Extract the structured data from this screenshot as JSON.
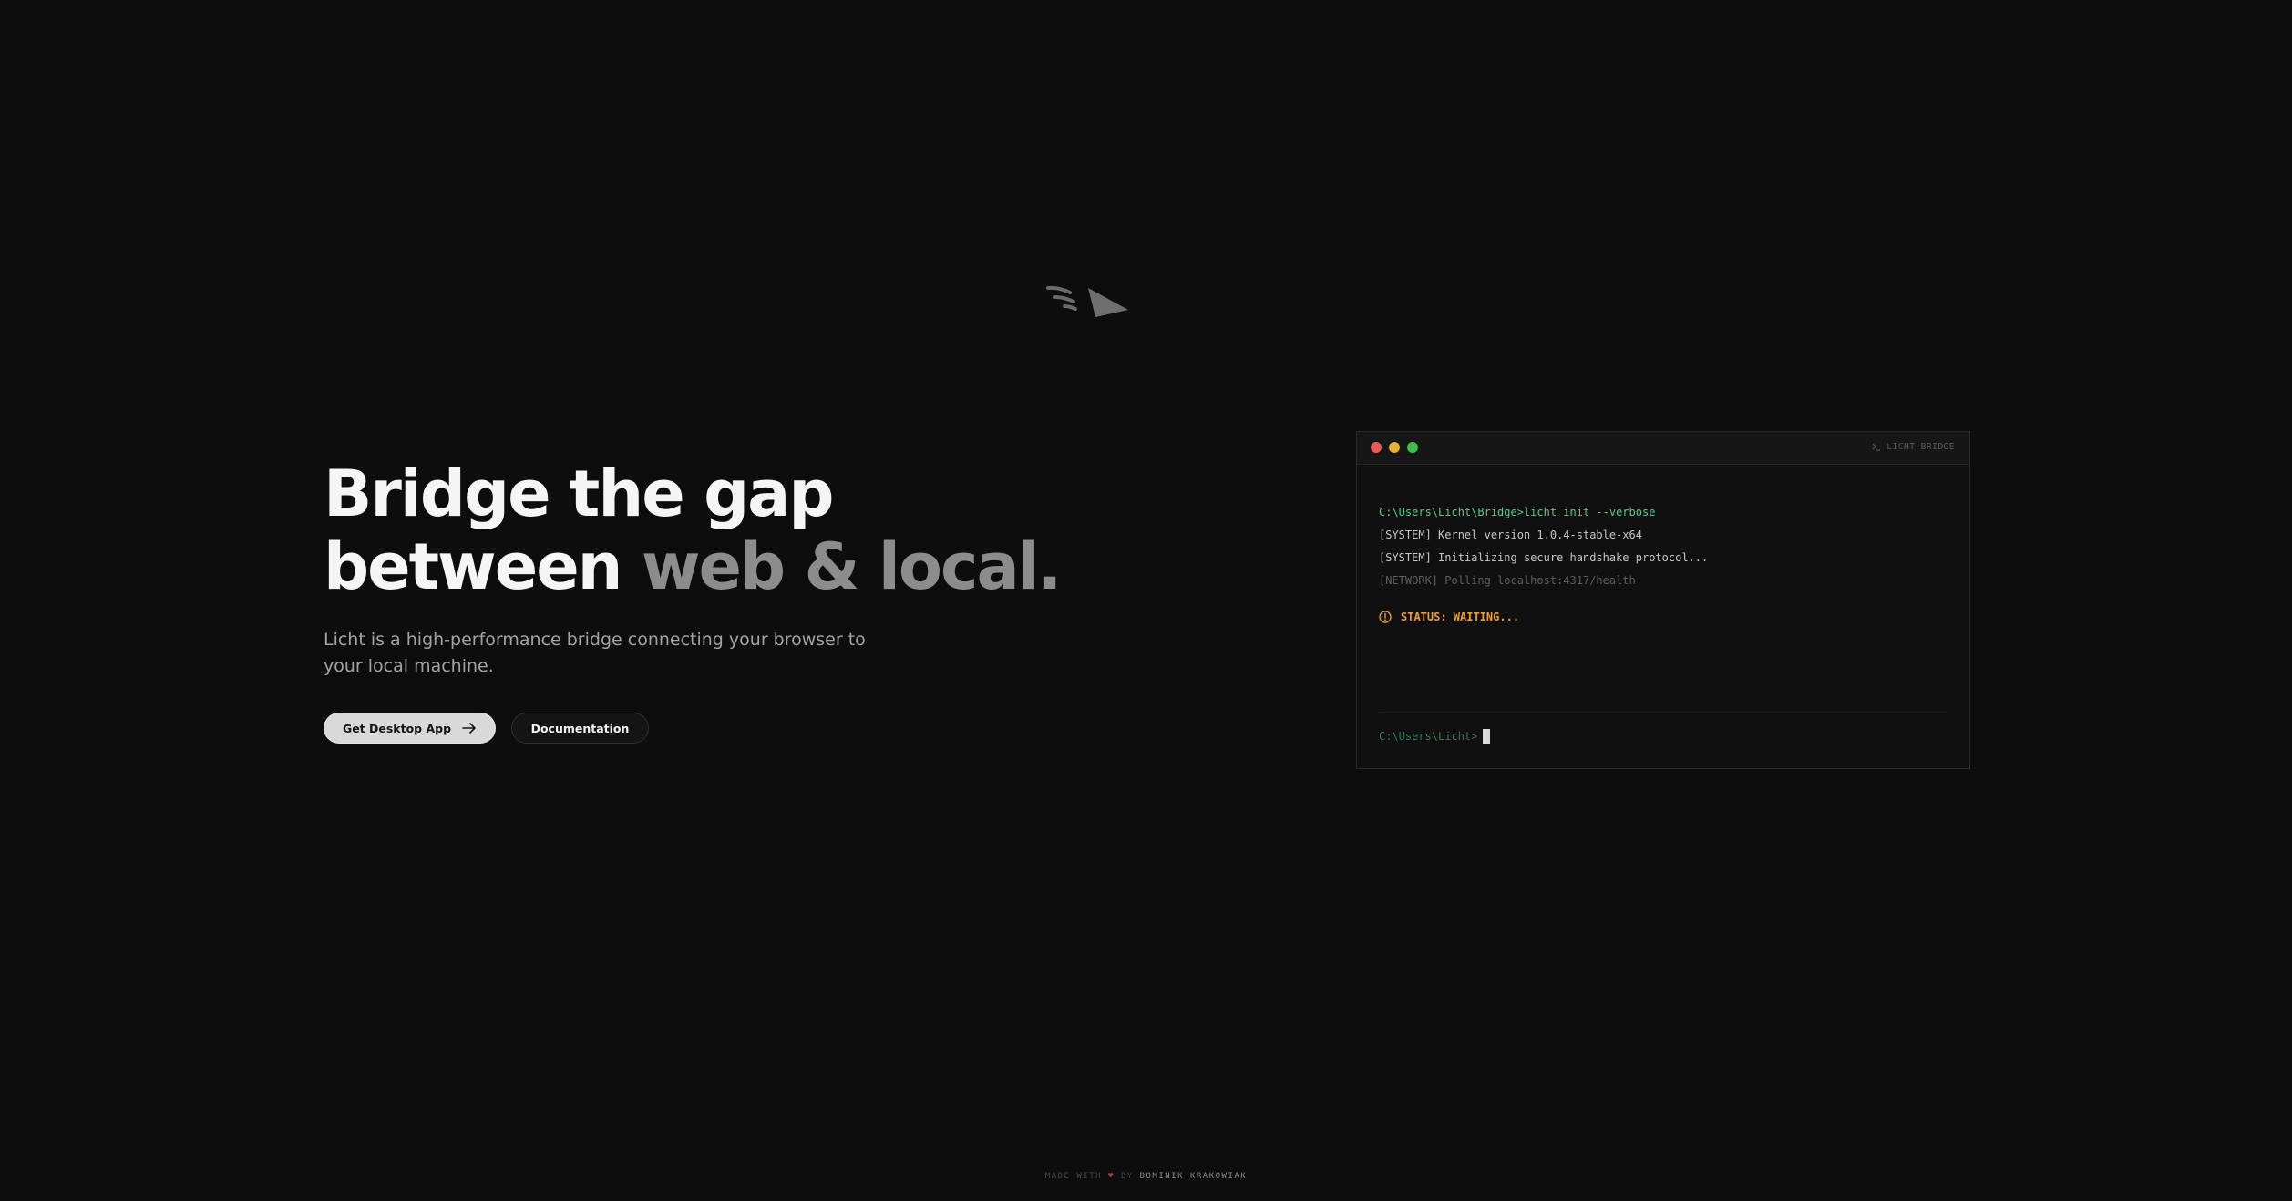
{
  "decor": {
    "plane_icon": "paper-plane-icon"
  },
  "hero": {
    "headline_line1": "Bridge the gap",
    "headline_line2_start": "between ",
    "headline_line2_highlight": "web & local.",
    "subtitle": "Licht is a high-performance bridge connecting your browser to your local machine.",
    "primary_button": "Get Desktop App",
    "primary_button_icon": "arrow-right-icon",
    "secondary_button": "Documentation"
  },
  "terminal": {
    "title": "LICHT-BRIDGE",
    "title_icon": "terminal-prompt-icon",
    "command": "C:\\Users\\Licht\\Bridge>licht init --verbose",
    "lines": [
      "[SYSTEM] Kernel version 1.0.4-stable-x64",
      "[SYSTEM] Initializing secure handshake protocol...",
      "[NETWORK] Polling localhost:4317/health"
    ],
    "status": "STATUS: WAITING...",
    "status_icon": "warning-circle-icon",
    "prompt": "C:\\Users\\Licht>",
    "colors": {
      "command": "#4fcf8a",
      "status": "#f0a12b",
      "dot_red": "#ee5a52",
      "dot_yellow": "#e6b22e",
      "dot_green": "#3bc14a"
    }
  },
  "footer": {
    "made_with": "MADE WITH",
    "heart": "♥",
    "by": "BY",
    "author": "DOMINIK KRAKOWIAK"
  }
}
